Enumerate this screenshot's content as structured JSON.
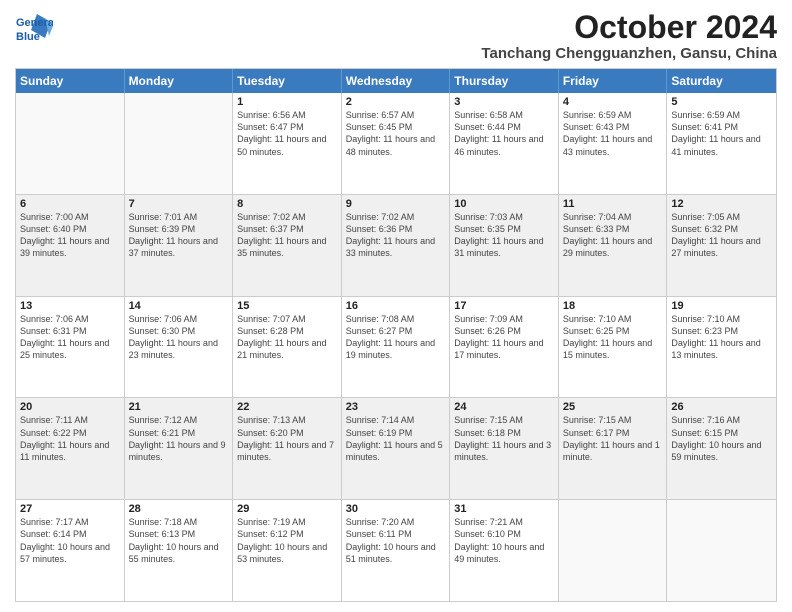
{
  "logo": {
    "line1": "General",
    "line2": "Blue"
  },
  "title": "October 2024",
  "location": "Tanchang Chengguanzhen, Gansu, China",
  "days": [
    "Sunday",
    "Monday",
    "Tuesday",
    "Wednesday",
    "Thursday",
    "Friday",
    "Saturday"
  ],
  "rows": [
    [
      {
        "day": "",
        "empty": true
      },
      {
        "day": "",
        "empty": true
      },
      {
        "day": "1",
        "sunrise": "6:56 AM",
        "sunset": "6:47 PM",
        "daylight": "11 hours and 50 minutes."
      },
      {
        "day": "2",
        "sunrise": "6:57 AM",
        "sunset": "6:45 PM",
        "daylight": "11 hours and 48 minutes."
      },
      {
        "day": "3",
        "sunrise": "6:58 AM",
        "sunset": "6:44 PM",
        "daylight": "11 hours and 46 minutes."
      },
      {
        "day": "4",
        "sunrise": "6:59 AM",
        "sunset": "6:43 PM",
        "daylight": "11 hours and 43 minutes."
      },
      {
        "day": "5",
        "sunrise": "6:59 AM",
        "sunset": "6:41 PM",
        "daylight": "11 hours and 41 minutes."
      }
    ],
    [
      {
        "day": "6",
        "sunrise": "7:00 AM",
        "sunset": "6:40 PM",
        "daylight": "11 hours and 39 minutes."
      },
      {
        "day": "7",
        "sunrise": "7:01 AM",
        "sunset": "6:39 PM",
        "daylight": "11 hours and 37 minutes."
      },
      {
        "day": "8",
        "sunrise": "7:02 AM",
        "sunset": "6:37 PM",
        "daylight": "11 hours and 35 minutes."
      },
      {
        "day": "9",
        "sunrise": "7:02 AM",
        "sunset": "6:36 PM",
        "daylight": "11 hours and 33 minutes."
      },
      {
        "day": "10",
        "sunrise": "7:03 AM",
        "sunset": "6:35 PM",
        "daylight": "11 hours and 31 minutes."
      },
      {
        "day": "11",
        "sunrise": "7:04 AM",
        "sunset": "6:33 PM",
        "daylight": "11 hours and 29 minutes."
      },
      {
        "day": "12",
        "sunrise": "7:05 AM",
        "sunset": "6:32 PM",
        "daylight": "11 hours and 27 minutes."
      }
    ],
    [
      {
        "day": "13",
        "sunrise": "7:06 AM",
        "sunset": "6:31 PM",
        "daylight": "11 hours and 25 minutes."
      },
      {
        "day": "14",
        "sunrise": "7:06 AM",
        "sunset": "6:30 PM",
        "daylight": "11 hours and 23 minutes."
      },
      {
        "day": "15",
        "sunrise": "7:07 AM",
        "sunset": "6:28 PM",
        "daylight": "11 hours and 21 minutes."
      },
      {
        "day": "16",
        "sunrise": "7:08 AM",
        "sunset": "6:27 PM",
        "daylight": "11 hours and 19 minutes."
      },
      {
        "day": "17",
        "sunrise": "7:09 AM",
        "sunset": "6:26 PM",
        "daylight": "11 hours and 17 minutes."
      },
      {
        "day": "18",
        "sunrise": "7:10 AM",
        "sunset": "6:25 PM",
        "daylight": "11 hours and 15 minutes."
      },
      {
        "day": "19",
        "sunrise": "7:10 AM",
        "sunset": "6:23 PM",
        "daylight": "11 hours and 13 minutes."
      }
    ],
    [
      {
        "day": "20",
        "sunrise": "7:11 AM",
        "sunset": "6:22 PM",
        "daylight": "11 hours and 11 minutes."
      },
      {
        "day": "21",
        "sunrise": "7:12 AM",
        "sunset": "6:21 PM",
        "daylight": "11 hours and 9 minutes."
      },
      {
        "day": "22",
        "sunrise": "7:13 AM",
        "sunset": "6:20 PM",
        "daylight": "11 hours and 7 minutes."
      },
      {
        "day": "23",
        "sunrise": "7:14 AM",
        "sunset": "6:19 PM",
        "daylight": "11 hours and 5 minutes."
      },
      {
        "day": "24",
        "sunrise": "7:15 AM",
        "sunset": "6:18 PM",
        "daylight": "11 hours and 3 minutes."
      },
      {
        "day": "25",
        "sunrise": "7:15 AM",
        "sunset": "6:17 PM",
        "daylight": "11 hours and 1 minute."
      },
      {
        "day": "26",
        "sunrise": "7:16 AM",
        "sunset": "6:15 PM",
        "daylight": "10 hours and 59 minutes."
      }
    ],
    [
      {
        "day": "27",
        "sunrise": "7:17 AM",
        "sunset": "6:14 PM",
        "daylight": "10 hours and 57 minutes."
      },
      {
        "day": "28",
        "sunrise": "7:18 AM",
        "sunset": "6:13 PM",
        "daylight": "10 hours and 55 minutes."
      },
      {
        "day": "29",
        "sunrise": "7:19 AM",
        "sunset": "6:12 PM",
        "daylight": "10 hours and 53 minutes."
      },
      {
        "day": "30",
        "sunrise": "7:20 AM",
        "sunset": "6:11 PM",
        "daylight": "10 hours and 51 minutes."
      },
      {
        "day": "31",
        "sunrise": "7:21 AM",
        "sunset": "6:10 PM",
        "daylight": "10 hours and 49 minutes."
      },
      {
        "day": "",
        "empty": true
      },
      {
        "day": "",
        "empty": true
      }
    ]
  ]
}
